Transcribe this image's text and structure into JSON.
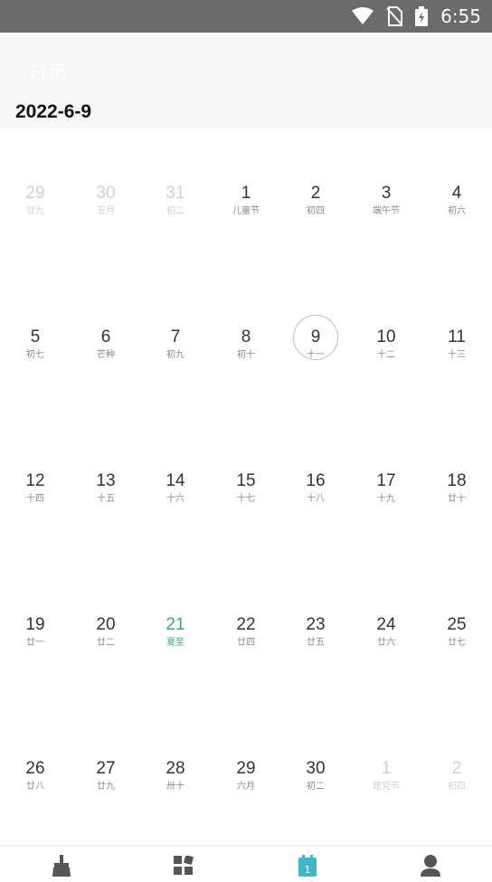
{
  "status_bar": {
    "time": "6:55"
  },
  "header": {
    "title": "日历",
    "date": "2022-6-9"
  },
  "weeks": [
    [
      {
        "day": "29",
        "lunar": "廿九",
        "dim": true
      },
      {
        "day": "30",
        "lunar": "五月",
        "dim": true
      },
      {
        "day": "31",
        "lunar": "初二",
        "dim": true
      },
      {
        "day": "1",
        "lunar": "儿童节"
      },
      {
        "day": "2",
        "lunar": "初四"
      },
      {
        "day": "3",
        "lunar": "端午节"
      },
      {
        "day": "4",
        "lunar": "初六"
      }
    ],
    [
      {
        "day": "5",
        "lunar": "初七"
      },
      {
        "day": "6",
        "lunar": "芒种"
      },
      {
        "day": "7",
        "lunar": "初九"
      },
      {
        "day": "8",
        "lunar": "初十"
      },
      {
        "day": "9",
        "lunar": "十一",
        "today": true
      },
      {
        "day": "10",
        "lunar": "十二"
      },
      {
        "day": "11",
        "lunar": "十三"
      }
    ],
    [
      {
        "day": "12",
        "lunar": "十四"
      },
      {
        "day": "13",
        "lunar": "十五"
      },
      {
        "day": "14",
        "lunar": "十六"
      },
      {
        "day": "15",
        "lunar": "十七"
      },
      {
        "day": "16",
        "lunar": "十八"
      },
      {
        "day": "17",
        "lunar": "十九"
      },
      {
        "day": "18",
        "lunar": "廿十"
      }
    ],
    [
      {
        "day": "19",
        "lunar": "廿一"
      },
      {
        "day": "20",
        "lunar": "廿二"
      },
      {
        "day": "21",
        "lunar": "夏至",
        "highlight": true
      },
      {
        "day": "22",
        "lunar": "廿四"
      },
      {
        "day": "23",
        "lunar": "廿五"
      },
      {
        "day": "24",
        "lunar": "廿六"
      },
      {
        "day": "25",
        "lunar": "廿七"
      }
    ],
    [
      {
        "day": "26",
        "lunar": "廿八"
      },
      {
        "day": "27",
        "lunar": "廿九"
      },
      {
        "day": "28",
        "lunar": "卅十"
      },
      {
        "day": "29",
        "lunar": "六月"
      },
      {
        "day": "30",
        "lunar": "初二"
      },
      {
        "day": "1",
        "lunar": "建党节",
        "dim": true
      },
      {
        "day": "2",
        "lunar": "初四",
        "dim": true
      }
    ]
  ],
  "bottom_nav": [
    {
      "name": "clean-tab",
      "icon": "broom-icon"
    },
    {
      "name": "apps-tab",
      "icon": "grid-icon"
    },
    {
      "name": "calendar-tab",
      "icon": "calendar-icon",
      "active": true,
      "badge": "1"
    },
    {
      "name": "profile-tab",
      "icon": "person-icon"
    }
  ],
  "colors": {
    "accent": "#3aa87a",
    "active_nav": "#3fb6c9",
    "status_bar": "#6b6b6b",
    "dim_text": "#cfcfcf"
  }
}
